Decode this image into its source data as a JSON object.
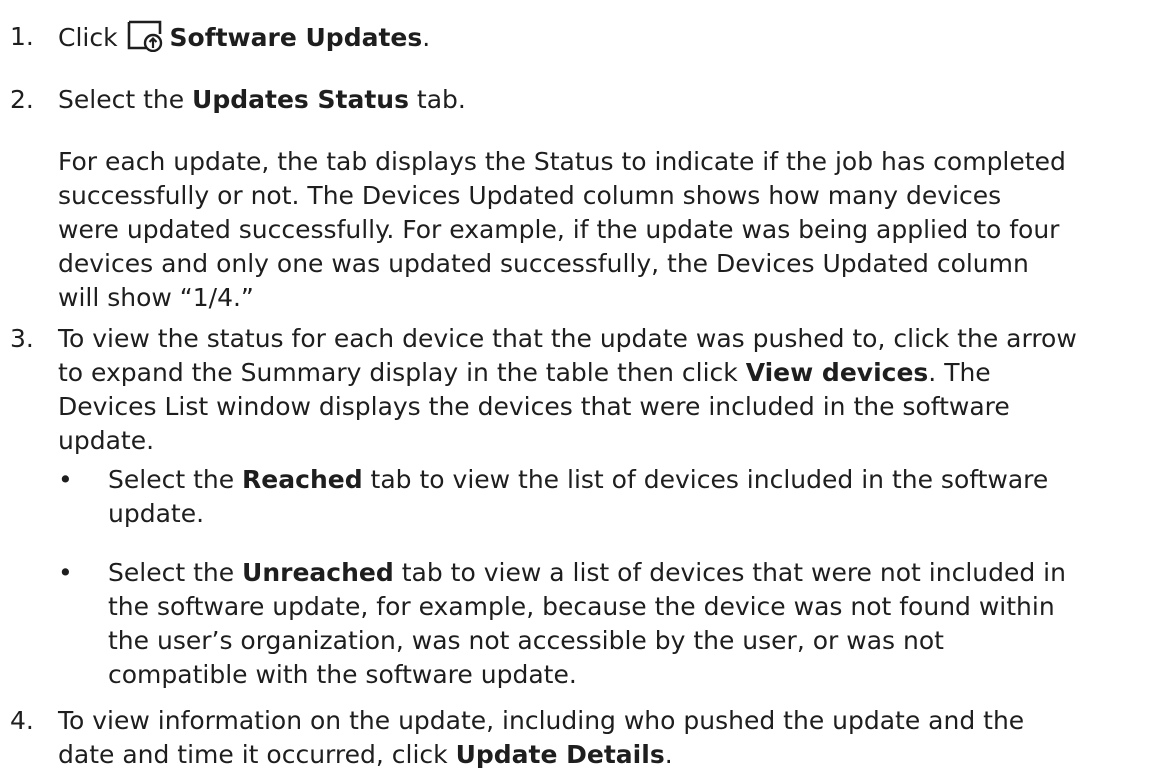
{
  "steps": [
    {
      "num": "1.",
      "pre": "Click",
      "icon": "software-update-icon",
      "bold": "Software Updates",
      "post": "."
    },
    {
      "num": "2.",
      "pre": "Select the ",
      "bold": "Updates Status",
      "post": " tab.",
      "note_lines": [
        "For each update, the tab displays the Status to indicate if the job has completed",
        "successfully or not. The Devices Updated column shows how many devices",
        "were updated successfully. For example, if the update was being applied to four",
        "devices and only one was updated successfully, the Devices Updated column",
        "will show “1/4.”"
      ]
    },
    {
      "num": "3.",
      "line1": "To view the status for each device that the update was pushed to, click the arrow",
      "line2_pre": "to expand the Summary display in the table then click ",
      "line2_bold": "View devices",
      "line2_post": ". The",
      "line3": "Devices List window displays the devices that were included in the software",
      "line4": "update.",
      "bullets": [
        {
          "dot": "•",
          "pre": "Select the ",
          "bold": "Reached",
          "line1_post": " tab to view the list of devices included in the software",
          "more_lines": [
            "update."
          ]
        },
        {
          "dot": "•",
          "pre": "Select the ",
          "bold": "Unreached",
          "line1_post": " tab to view a list of devices that were not included in",
          "more_lines": [
            "the software update, for example, because the device was not found within",
            "the user’s organization, was not accessible by the user, or was not",
            "compatible with the software update."
          ]
        }
      ]
    },
    {
      "num": "4.",
      "line1": "To view information on the update, including who pushed the update and the",
      "line2_pre": "date and time it occurred, click ",
      "line2_bold": "Update Details",
      "line2_post": "."
    }
  ]
}
